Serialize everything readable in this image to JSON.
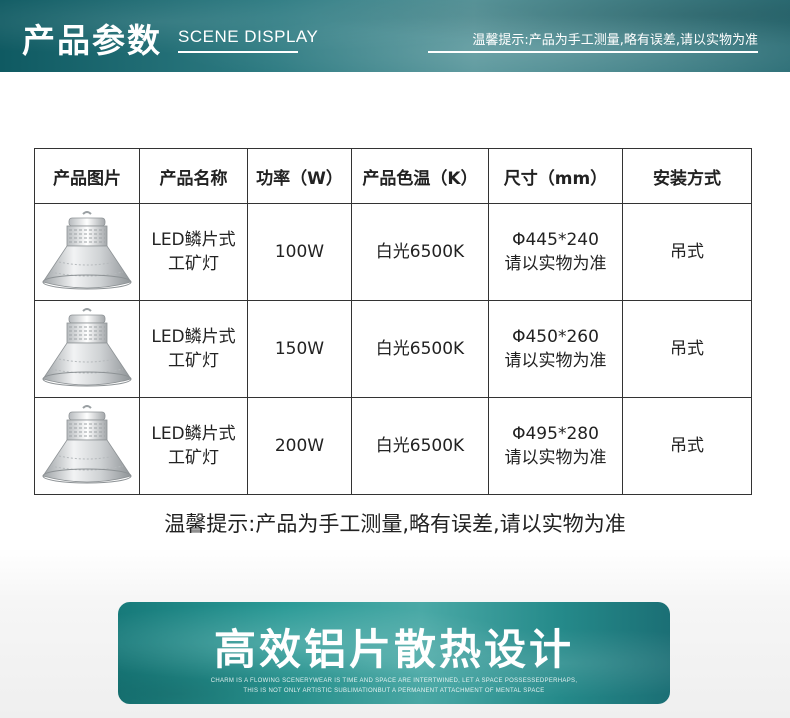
{
  "header": {
    "title": "产品参数",
    "subtitle": "SCENE DISPLAY",
    "tip": "温馨提示:产品为手工测量,略有误差,请以实物为准"
  },
  "table": {
    "columns": [
      "产品图片",
      "产品名称",
      "功率（W）",
      "产品色温（K）",
      "尺寸（mm）",
      "安装方式"
    ],
    "rows": [
      {
        "image": "high-bay-lamp",
        "name_line1": "LED鳞片式",
        "name_line2": "工矿灯",
        "power": "100W",
        "color_temp": "白光6500K",
        "size_line1": "Φ445*240",
        "size_line2": "请以实物为准",
        "install": "吊式"
      },
      {
        "image": "high-bay-lamp",
        "name_line1": "LED鳞片式",
        "name_line2": "工矿灯",
        "power": "150W",
        "color_temp": "白光6500K",
        "size_line1": "Φ450*260",
        "size_line2": "请以实物为准",
        "install": "吊式"
      },
      {
        "image": "high-bay-lamp",
        "name_line1": "LED鳞片式",
        "name_line2": "工矿灯",
        "power": "200W",
        "color_temp": "白光6500K",
        "size_line1": "Φ495*280",
        "size_line2": "请以实物为准",
        "install": "吊式"
      }
    ]
  },
  "note": "温馨提示:产品为手工测量,略有误差,请以实物为准",
  "feature_banner": {
    "title": "高效铝片散热设计",
    "caption_line1": "CHARM IS A FLOWING SCENERYWEAR IS TIME AND SPACE ARE INTERTWINED, LET A SPACE POSSESSEDPERHAPS,",
    "caption_line2": "THIS IS NOT ONLY ARTISTIC SUBLIMATIONBUT A PERMANENT ATTACHMENT OF MENTAL SPACE"
  },
  "colors": {
    "banner_teal": "#2f7c83",
    "feature_teal": "#2a9a96",
    "text": "#222222",
    "border": "#333333"
  }
}
